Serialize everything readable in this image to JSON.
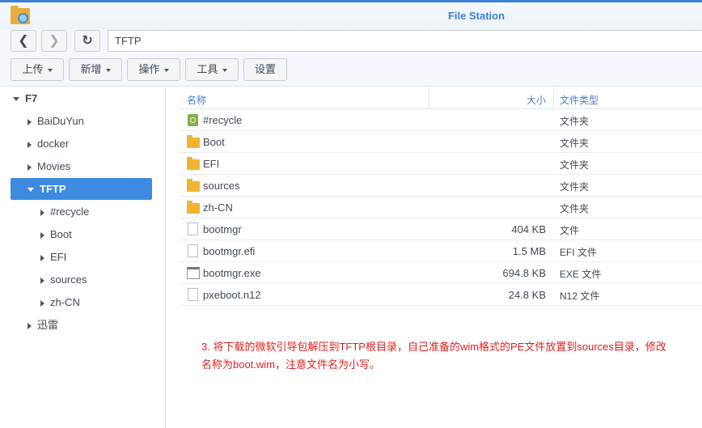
{
  "app": {
    "title": "File Station"
  },
  "nav": {
    "path": "TFTP"
  },
  "toolbar": {
    "upload": "上传",
    "create": "新增",
    "action": "操作",
    "tools": "工具",
    "settings": "设置"
  },
  "tree": [
    {
      "label": "F7",
      "level": 0,
      "state": "open"
    },
    {
      "label": "BaiDuYun",
      "level": 1,
      "state": "closed"
    },
    {
      "label": "docker",
      "level": 1,
      "state": "closed"
    },
    {
      "label": "Movies",
      "level": 1,
      "state": "closed"
    },
    {
      "label": "TFTP",
      "level": 1,
      "state": "open",
      "selected": true
    },
    {
      "label": "#recycle",
      "level": 2,
      "state": "closed"
    },
    {
      "label": "Boot",
      "level": 2,
      "state": "closed"
    },
    {
      "label": "EFI",
      "level": 2,
      "state": "closed"
    },
    {
      "label": "sources",
      "level": 2,
      "state": "closed"
    },
    {
      "label": "zh-CN",
      "level": 2,
      "state": "closed"
    },
    {
      "label": "迅雷",
      "level": 1,
      "state": "closed"
    }
  ],
  "columns": {
    "name": "名称",
    "size": "大小",
    "type": "文件类型"
  },
  "files": [
    {
      "name": "#recycle",
      "size": "",
      "type": "文件夹",
      "icon": "recycle"
    },
    {
      "name": "Boot",
      "size": "",
      "type": "文件夹",
      "icon": "folder"
    },
    {
      "name": "EFI",
      "size": "",
      "type": "文件夹",
      "icon": "folder"
    },
    {
      "name": "sources",
      "size": "",
      "type": "文件夹",
      "icon": "folder"
    },
    {
      "name": "zh-CN",
      "size": "",
      "type": "文件夹",
      "icon": "folder"
    },
    {
      "name": "bootmgr",
      "size": "404 KB",
      "type": "文件",
      "icon": "file"
    },
    {
      "name": "bootmgr.efi",
      "size": "1.5 MB",
      "type": "EFI 文件",
      "icon": "file"
    },
    {
      "name": "bootmgr.exe",
      "size": "694.8 KB",
      "type": "EXE 文件",
      "icon": "exe"
    },
    {
      "name": "pxeboot.n12",
      "size": "24.8 KB",
      "type": "N12 文件",
      "icon": "file"
    }
  ],
  "note": {
    "line1": "3. 将下载的微软引导包解压到TFTP根目录，自己准备的wim格式的PE文件放置到sources目录，修改",
    "line2": "名称为boot.wim，注意文件名为小写。"
  }
}
